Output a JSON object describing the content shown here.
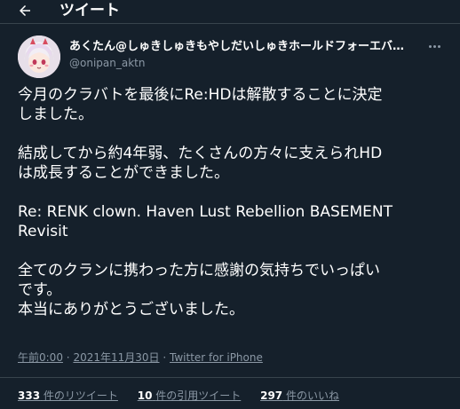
{
  "header": {
    "title": "ツイート",
    "back_icon": "arrow-left-icon"
  },
  "tweet": {
    "display_name": "あくたん@しゅきしゅきもやしだいしゅきホールドフォーエバーラ...",
    "handle": "@onipan_aktn",
    "more_icon": "more-horizontal-icon",
    "lines": [
      "今月のクラバトを最後にRe:HDは解散することに決定",
      "しました。",
      "",
      "結成してから約4年弱、たくさんの方々に支えられHD",
      "は成長することができました。",
      "",
      "Re: RENK clown. Haven Lust Rebellion BASEMENT",
      "Revisit",
      "",
      "全てのクランに携わった方に感謝の気持ちでいっぱい",
      "です。",
      "本当にありがとうございました。"
    ],
    "time": "午前0:00",
    "separator": "·",
    "date": "2021年11月30日",
    "source": "Twitter for iPhone"
  },
  "stats": {
    "retweets_count": "333",
    "retweets_label": "件のリツイート",
    "quotes_count": "10",
    "quotes_label": "件の引用ツイート",
    "likes_count": "297",
    "likes_label": "件のいいね"
  },
  "colors": {
    "background": "#15202b",
    "secondary_text": "#8b98a5",
    "divider": "#38444d"
  }
}
